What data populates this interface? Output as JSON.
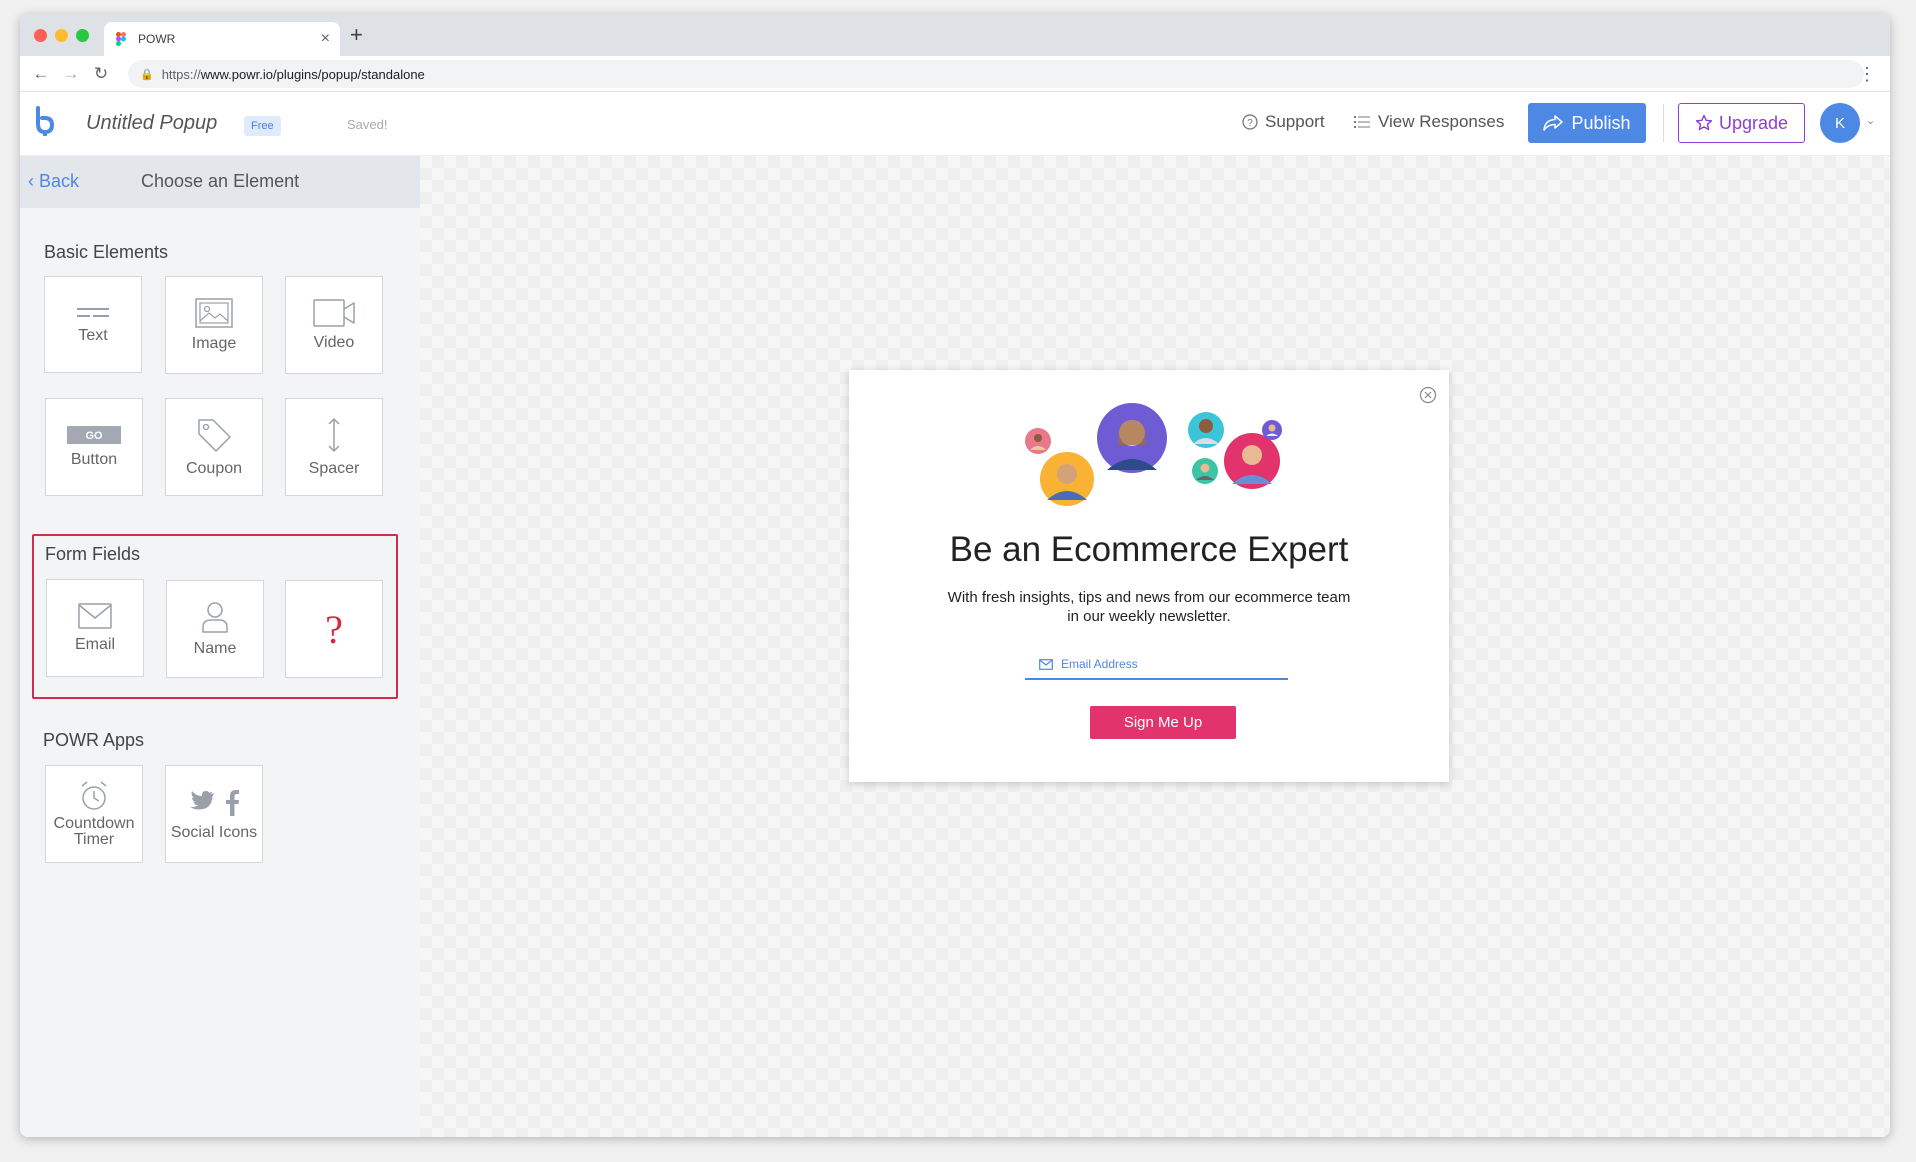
{
  "browser": {
    "tab_title": "POWR",
    "url_scheme": "https://",
    "url_rest": "www.powr.io/plugins/popup/standalone"
  },
  "header": {
    "popup_name": "Untitled Popup",
    "plan_badge": "Free",
    "save_status": "Saved!",
    "support_label": "Support",
    "view_responses_label": "View Responses",
    "publish_label": "Publish",
    "upgrade_label": "Upgrade",
    "avatar_initial": "K"
  },
  "sidebar": {
    "back_label": "Back",
    "title": "Choose an Element",
    "basic": {
      "title": "Basic Elements",
      "items": [
        "Text",
        "Image",
        "Video",
        "Button",
        "Coupon",
        "Spacer"
      ],
      "button_icon_text": "GO"
    },
    "form": {
      "title": "Form Fields",
      "items": [
        "Email",
        "Name"
      ],
      "unknown_glyph": "?"
    },
    "apps": {
      "title": "POWR Apps",
      "items": [
        "Countdown Timer",
        "Social Icons"
      ]
    }
  },
  "popup": {
    "headline": "Be an Ecommerce Expert",
    "subline": "With fresh insights, tips and news from our ecommerce team in our weekly newsletter.",
    "email_placeholder": "Email Address",
    "cta_label": "Sign Me Up"
  },
  "colors": {
    "accent": "#4e88e5",
    "upgrade": "#8b3fd6",
    "cta": "#e2336c",
    "highlight_border": "#cf2d4a"
  }
}
